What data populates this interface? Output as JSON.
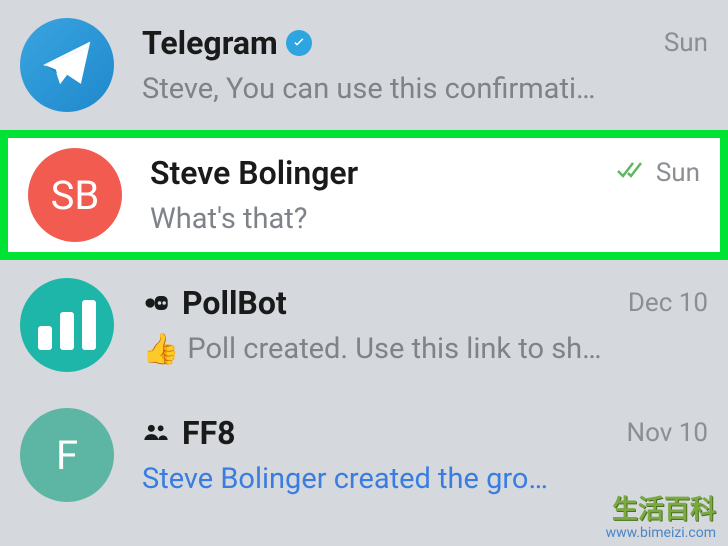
{
  "chats": [
    {
      "name": "Telegram",
      "preview": "Steve,  You can use this confirmati…",
      "timestamp": "Sun",
      "verified": true
    },
    {
      "name": "Steve Bolinger",
      "preview": "What's that?",
      "timestamp": "Sun",
      "avatar_initials": "SB",
      "read": true
    },
    {
      "name": "PollBot",
      "preview": "Poll created. Use this link to sh…",
      "timestamp": "Dec 10",
      "emoji": "👍",
      "is_bot": true
    },
    {
      "name": "FF8",
      "preview": "Steve Bolinger created the gro…",
      "timestamp": "Nov 10",
      "avatar_initials": "F",
      "is_group": true
    }
  ],
  "watermark": {
    "cn": "生活百科",
    "url": "www.bimeizi.com"
  }
}
